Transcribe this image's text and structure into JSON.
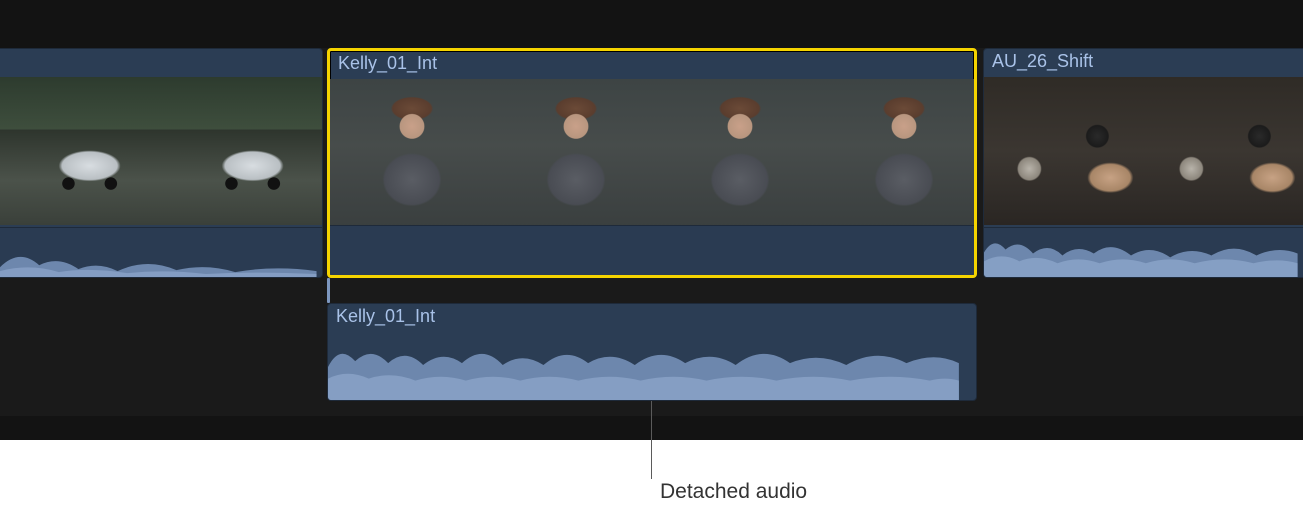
{
  "timeline": {
    "video_track": {
      "clips": [
        {
          "name": "",
          "selected": false
        },
        {
          "name": "Kelly_01_Int",
          "selected": true
        },
        {
          "name": "AU_26_Shift",
          "selected": false
        }
      ]
    },
    "detached_audio": {
      "name": "Kelly_01_Int"
    }
  },
  "callout": {
    "label": "Detached audio"
  }
}
